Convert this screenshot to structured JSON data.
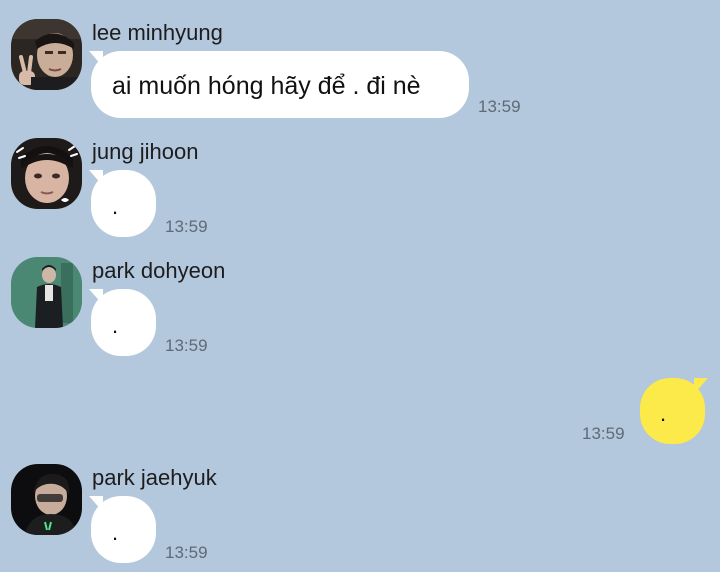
{
  "messages": [
    {
      "sender": "lee minhyung",
      "text": "ai muốn hóng hãy để . đi nè",
      "time": "13:59",
      "direction": "incoming"
    },
    {
      "sender": "jung jihoon",
      "text": ".",
      "time": "13:59",
      "direction": "incoming"
    },
    {
      "sender": "park dohyeon",
      "text": ".",
      "time": "13:59",
      "direction": "incoming"
    },
    {
      "sender": "",
      "text": ".",
      "time": "13:59",
      "direction": "outgoing"
    },
    {
      "sender": "park jaehyuk",
      "text": ".",
      "time": "13:59",
      "direction": "incoming"
    }
  ],
  "colors": {
    "background": "#b3c7dd",
    "incoming_bubble": "#ffffff",
    "outgoing_bubble": "#fce94a",
    "timestamp": "#5f6b76"
  }
}
